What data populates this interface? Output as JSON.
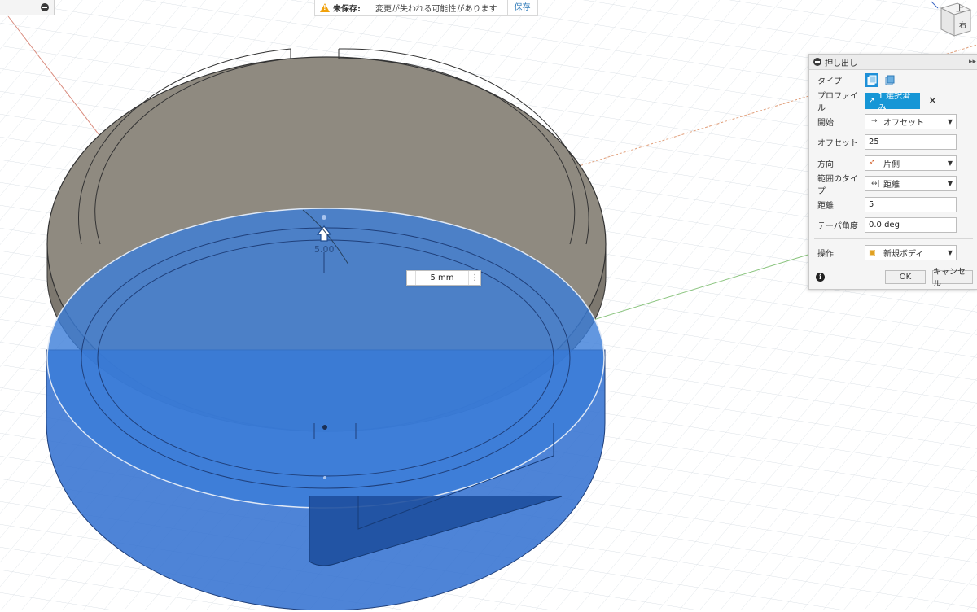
{
  "banner": {
    "title": "未保存:",
    "message": "変更が失われる可能性があります",
    "save_label": "保存"
  },
  "viewcube": {
    "top_face": "上",
    "right_face": "右"
  },
  "canvas": {
    "dimension_label": "5.00",
    "dimension_input": "5 mm"
  },
  "panel": {
    "title": "押し出し",
    "rows": {
      "type": {
        "label": "タイプ"
      },
      "profile": {
        "label": "プロファイル",
        "value": "1 選択済み"
      },
      "start": {
        "label": "開始",
        "value": "オフセット"
      },
      "offset": {
        "label": "オフセット",
        "value": "25"
      },
      "direction": {
        "label": "方向",
        "value": "片側"
      },
      "extent_type": {
        "label": "範囲のタイプ",
        "value": "距離"
      },
      "distance": {
        "label": "距離",
        "value": "5"
      },
      "taper": {
        "label": "テーパ角度",
        "value": "0.0 deg"
      },
      "operation": {
        "label": "操作",
        "value": "新規ボディ"
      }
    },
    "ok_label": "OK",
    "cancel_label": "キャンセル"
  },
  "colors": {
    "accent": "#1696d6",
    "body_gray": "#8f8a80",
    "selection_blue": "#2f6fd0",
    "warning": "#f1a10a"
  }
}
